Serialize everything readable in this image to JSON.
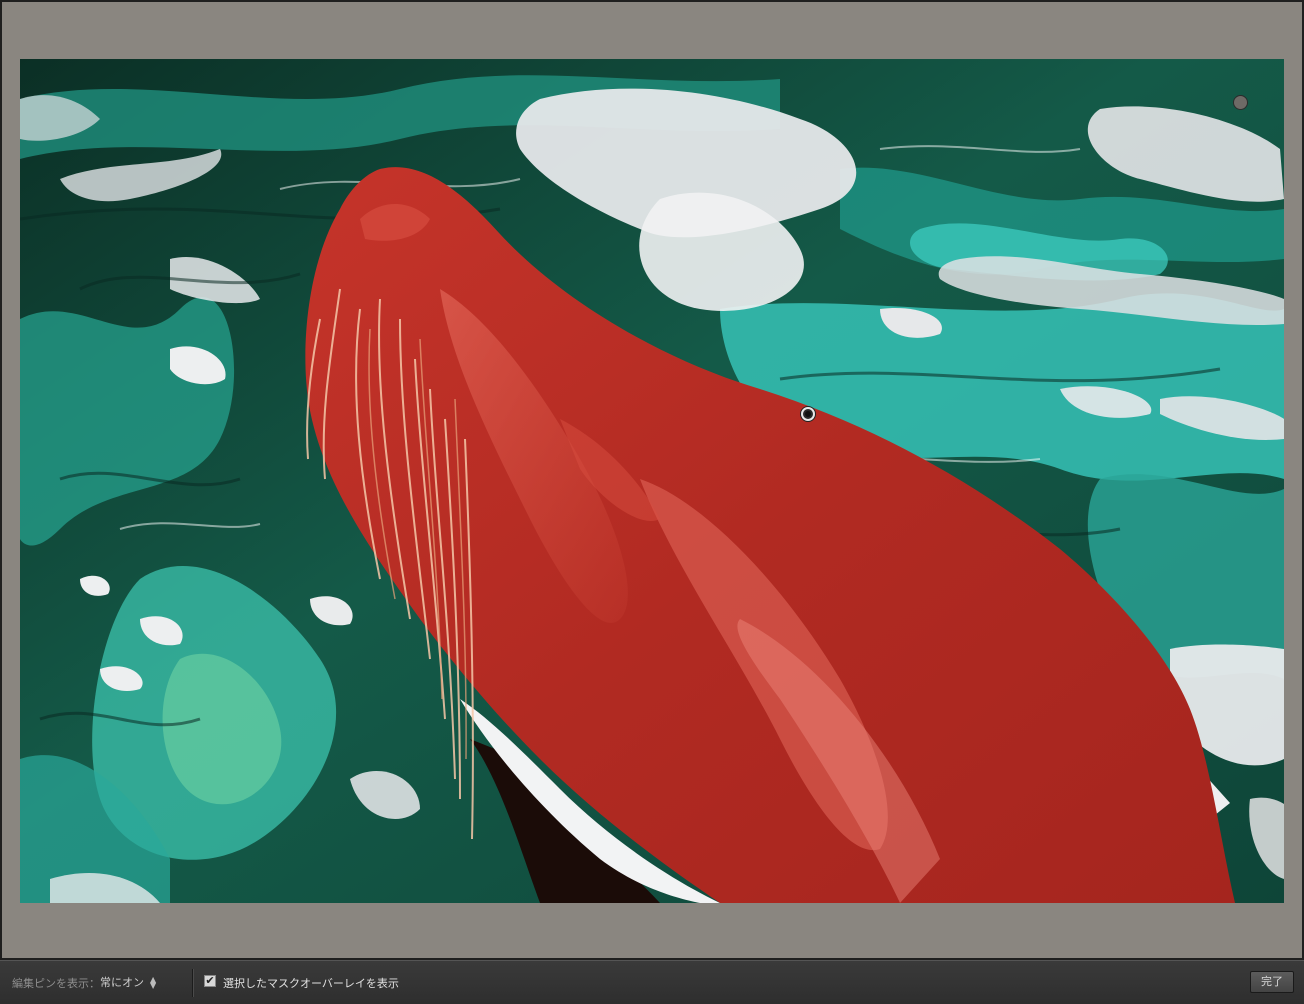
{
  "toolbar": {
    "show_pins_label": "編集ピンを表示：",
    "show_pins_value": "常にオン",
    "overlay_checkbox_checked": "✔",
    "overlay_label": "選択したマスクオーバーレイを表示",
    "done_label": "完了"
  },
  "colors": {
    "canvas_background": "#8a8680",
    "mask_overlay": "#b3261e",
    "water_dark": "#0d3a2e",
    "water_teal": "#2fb8a8",
    "water_highlight": "#e6e8ea"
  },
  "icons": {
    "select_arrows": "updown-arrows-icon"
  }
}
